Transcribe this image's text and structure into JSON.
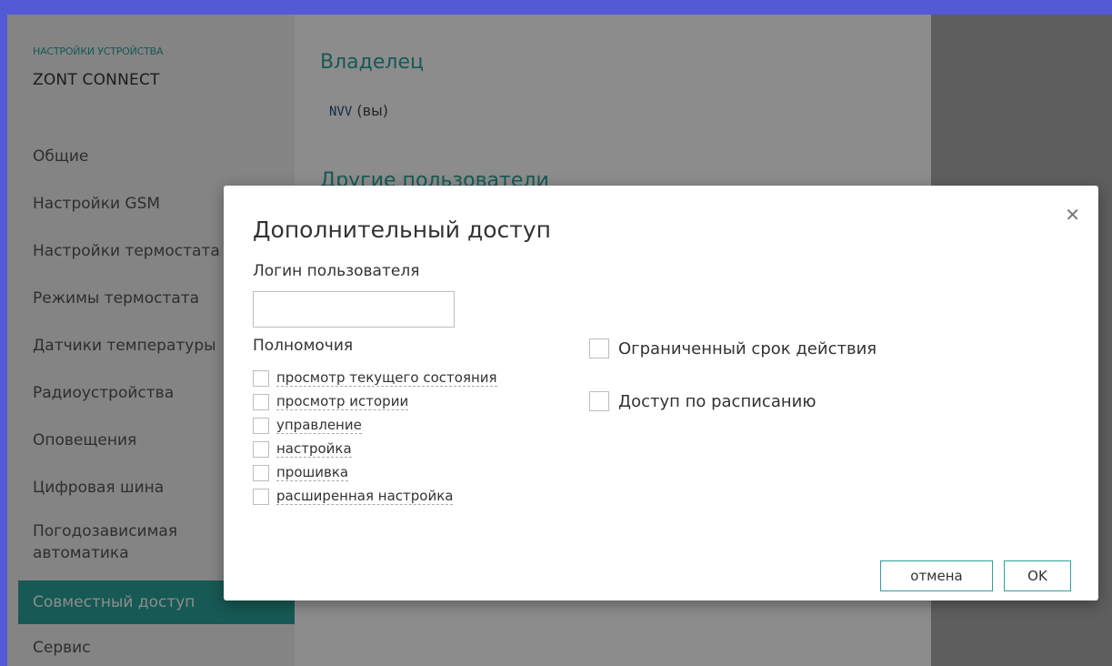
{
  "sidebar": {
    "caption": "НАСТРОЙКИ УСТРОЙСТВА",
    "device": "ZONT CONNECT",
    "items": [
      {
        "label": "Общие"
      },
      {
        "label": "Настройки GSM"
      },
      {
        "label": "Настройки термостата"
      },
      {
        "label": "Режимы термостата"
      },
      {
        "label": "Датчики температуры"
      },
      {
        "label": "Радиоустройства"
      },
      {
        "label": "Оповещения"
      },
      {
        "label": "Цифровая шина"
      },
      {
        "label": "Погодозависимая автоматика"
      },
      {
        "label": "Совместный доступ",
        "active": true
      },
      {
        "label": "Сервис"
      }
    ]
  },
  "main": {
    "owner_heading": "Владелец",
    "owner_login": "NVV",
    "owner_suffix": "(вы)",
    "other_heading": "Другие пользователи"
  },
  "modal": {
    "title": "Дополнительный доступ",
    "close_icon": "close-icon",
    "login_label": "Логин пользователя",
    "login_value": "",
    "permissions_label": "Полномочия",
    "permissions": [
      {
        "label": "просмотр текущего состояния",
        "checked": false
      },
      {
        "label": "просмотр истории",
        "checked": false
      },
      {
        "label": "управление",
        "checked": false
      },
      {
        "label": "настройка",
        "checked": false
      },
      {
        "label": "прошивка",
        "checked": false
      },
      {
        "label": "расширенная настройка",
        "checked": false
      }
    ],
    "limited_term_label": "Ограниченный срок действия",
    "schedule_label": "Доступ по расписанию",
    "cancel_label": "отмена",
    "ok_label": "OK"
  },
  "colors": {
    "accent": "#2aa39a",
    "frame": "#5459d6",
    "sidebar_bg": "#f0f0f0"
  }
}
